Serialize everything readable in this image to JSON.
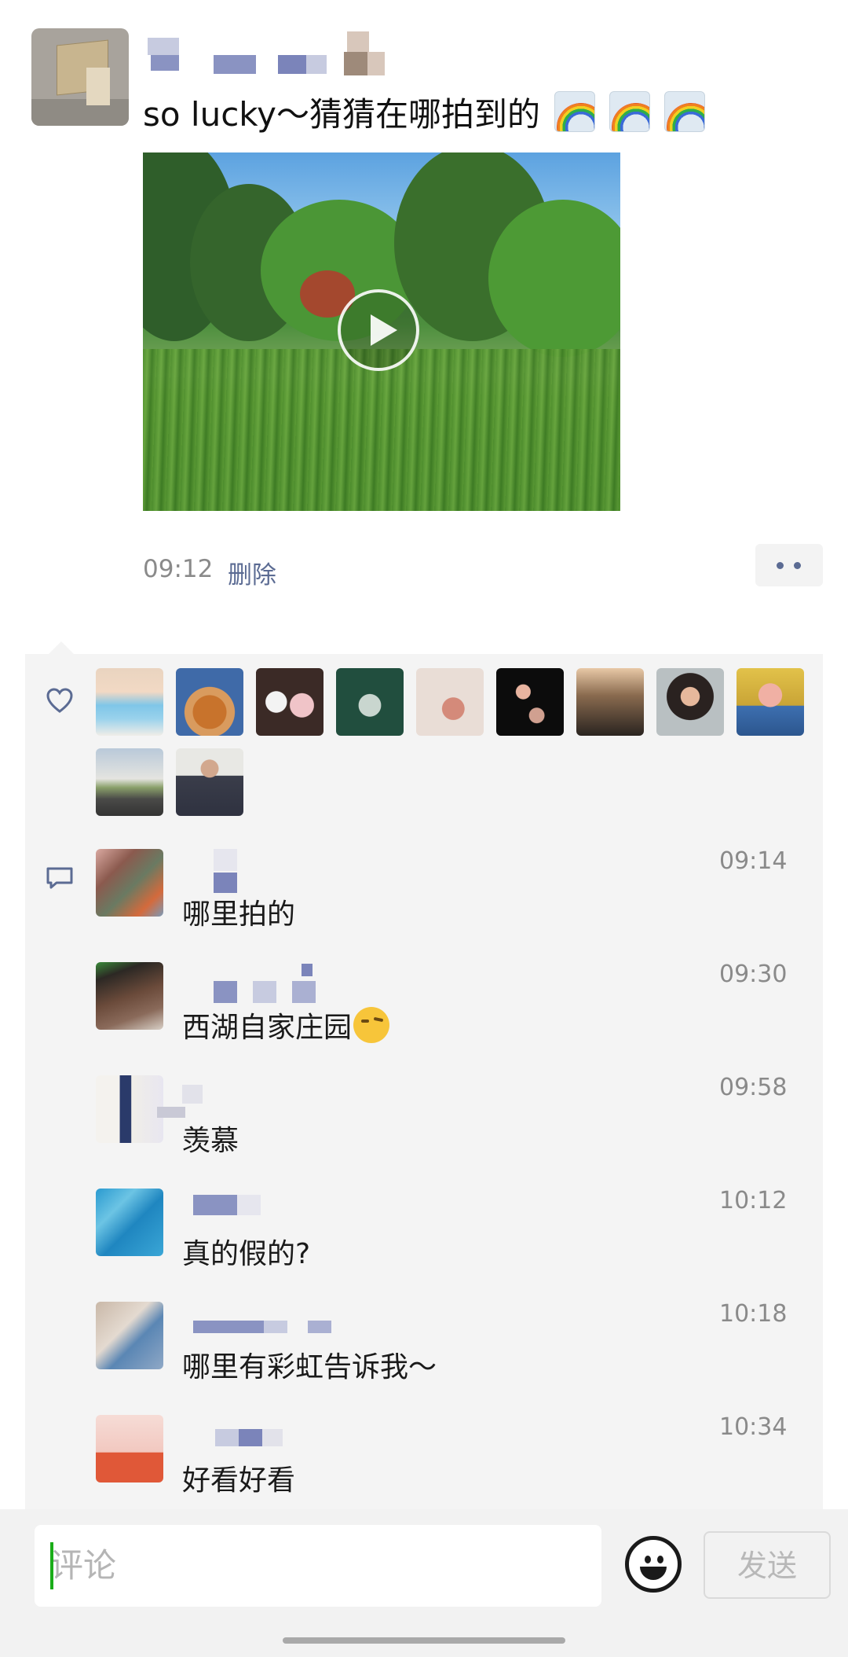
{
  "post": {
    "text": "so lucky～猜猜在哪拍到的",
    "time": "09:12",
    "delete_label": "删除"
  },
  "comments": [
    {
      "text": "哪里拍的",
      "time": "09:14"
    },
    {
      "text": "西湖自家庄园",
      "time": "09:30"
    },
    {
      "text": "羡慕",
      "time": "09:58"
    },
    {
      "text": "真的假的?",
      "time": "10:12"
    },
    {
      "text": "哪里有彩虹告诉我～",
      "time": "10:18"
    },
    {
      "text": "好看好看",
      "time": "10:34"
    }
  ],
  "input": {
    "placeholder": "评论",
    "send_label": "发送"
  },
  "icons": {
    "like": "heart-icon",
    "comment": "comment-bubble-icon",
    "emoji": "emoji-smile-icon",
    "play": "play-icon",
    "more": "more-dots-icon"
  },
  "colors": {
    "link": "#5b6b93",
    "caret": "#1aad19",
    "panel": "#f4f4f4"
  }
}
